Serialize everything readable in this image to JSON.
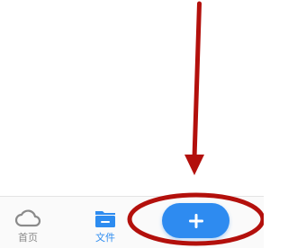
{
  "tabbar": {
    "items": [
      {
        "label": "首页",
        "icon": "cloud-icon",
        "active": false
      },
      {
        "label": "文件",
        "icon": "folder-icon",
        "active": true
      }
    ],
    "add_button": {
      "icon": "plus-icon"
    }
  },
  "colors": {
    "accent": "#2e8bf0",
    "inactive": "#8a8a8a",
    "annotation": "#b3100c"
  }
}
